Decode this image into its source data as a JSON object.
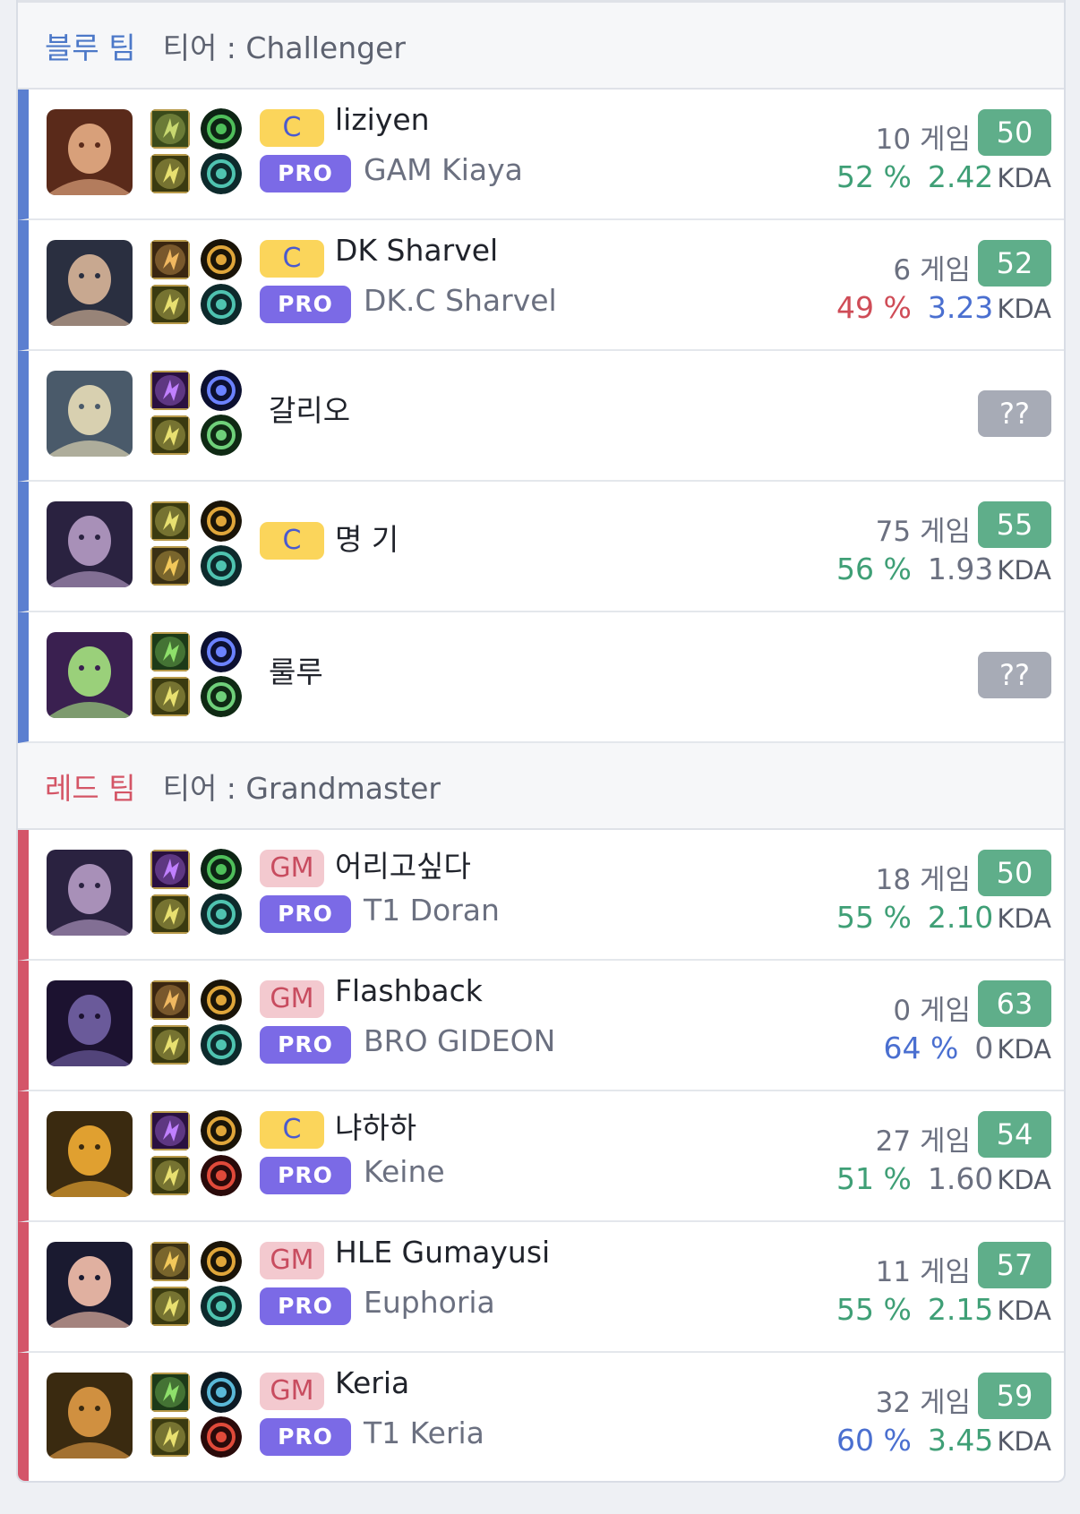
{
  "blue_team": {
    "name": "블루 팀",
    "tier_label": "티어 : Challenger",
    "players": [
      {
        "champion": "champion-portrait-talon",
        "spells": [
          "ghost",
          "flash"
        ],
        "runes": [
          "domination-keystone",
          "sorcery"
        ],
        "rank_badge": "C",
        "name": "liziyen",
        "pro_label": "PRO",
        "pro_name": "GAM Kiaya",
        "games": "10 게임",
        "lp": "50",
        "winrate": "52 %",
        "winrate_color": "green",
        "kda": "2.42",
        "kda_color": "green",
        "kda_unit": "KDA"
      },
      {
        "champion": "champion-portrait-jayce",
        "spells": [
          "teleport",
          "flash"
        ],
        "runes": [
          "precision-keystone",
          "sorcery"
        ],
        "rank_badge": "C",
        "name": "DK Sharvel",
        "pro_label": "PRO",
        "pro_name": "DK.C Sharvel",
        "games": "6 게임",
        "lp": "52",
        "winrate": "49 %",
        "winrate_color": "red",
        "kda": "3.23",
        "kda_color": "blue",
        "kda_unit": "KDA"
      },
      {
        "champion": "champion-portrait-galio",
        "spells": [
          "ignite",
          "flash"
        ],
        "runes": [
          "sorcery-keystone",
          "resolve"
        ],
        "rank_badge": "",
        "name": "갈리오",
        "pro_label": "",
        "pro_name": "",
        "games": "",
        "lp": "??",
        "winrate": "",
        "winrate_color": "gray",
        "kda": "",
        "kda_color": "gray",
        "kda_unit": ""
      },
      {
        "champion": "champion-portrait-aatrox",
        "spells": [
          "flash",
          "smite"
        ],
        "runes": [
          "precision-keystone",
          "sorcery"
        ],
        "rank_badge": "C",
        "name": "명 기",
        "pro_label": "",
        "pro_name": "",
        "games": "75 게임",
        "lp": "55",
        "winrate": "56 %",
        "winrate_color": "green",
        "kda": "1.93",
        "kda_color": "gray",
        "kda_unit": "KDA"
      },
      {
        "champion": "champion-portrait-lulu",
        "spells": [
          "heal",
          "flash"
        ],
        "runes": [
          "sorcery-keystone",
          "resolve"
        ],
        "rank_badge": "",
        "name": "룰루",
        "pro_label": "",
        "pro_name": "",
        "games": "",
        "lp": "??",
        "winrate": "",
        "winrate_color": "gray",
        "kda": "",
        "kda_color": "gray",
        "kda_unit": ""
      }
    ]
  },
  "red_team": {
    "name": "레드 팀",
    "tier_label": "티어 : Grandmaster",
    "players": [
      {
        "champion": "champion-portrait-aatrox",
        "spells": [
          "ignite",
          "flash"
        ],
        "runes": [
          "domination-keystone",
          "sorcery"
        ],
        "rank_badge": "GM",
        "name": "어리고싶다",
        "pro_label": "PRO",
        "pro_name": "T1 Doran",
        "games": "18 게임",
        "lp": "50",
        "winrate": "55 %",
        "winrate_color": "green",
        "kda": "2.10",
        "kda_color": "green",
        "kda_unit": "KDA"
      },
      {
        "champion": "champion-portrait-kha-zix",
        "spells": [
          "teleport",
          "flash"
        ],
        "runes": [
          "precision-keystone",
          "sorcery"
        ],
        "rank_badge": "GM",
        "name": "Flashback",
        "pro_label": "PRO",
        "pro_name": "BRO GIDEON",
        "games": "0 게임",
        "lp": "63",
        "winrate": "64 %",
        "winrate_color": "blue",
        "kda": "0",
        "kda_color": "gray",
        "kda_unit": "KDA"
      },
      {
        "champion": "champion-portrait-azir",
        "spells": [
          "ignite",
          "flash"
        ],
        "runes": [
          "precision-keystone",
          "domination"
        ],
        "rank_badge": "C",
        "name": "냐하하",
        "pro_label": "PRO",
        "pro_name": "Keine",
        "games": "27 게임",
        "lp": "54",
        "winrate": "51 %",
        "winrate_color": "green",
        "kda": "1.60",
        "kda_color": "gray",
        "kda_unit": "KDA"
      },
      {
        "champion": "champion-portrait-caitlyn",
        "spells": [
          "smite",
          "flash"
        ],
        "runes": [
          "precision-keystone",
          "sorcery"
        ],
        "rank_badge": "GM",
        "name": "HLE Gumayusi",
        "pro_label": "PRO",
        "pro_name": "Euphoria",
        "games": "11 게임",
        "lp": "57",
        "winrate": "55 %",
        "winrate_color": "green",
        "kda": "2.15",
        "kda_color": "green",
        "kda_unit": "KDA"
      },
      {
        "champion": "champion-portrait-blitzcrank",
        "spells": [
          "heal",
          "flash"
        ],
        "runes": [
          "inspiration-keystone",
          "domination"
        ],
        "rank_badge": "GM",
        "name": "Keria",
        "pro_label": "PRO",
        "pro_name": "T1 Keria",
        "games": "32 게임",
        "lp": "59",
        "winrate": "60 %",
        "winrate_color": "blue",
        "kda": "3.45",
        "kda_color": "green",
        "kda_unit": "KDA"
      }
    ]
  }
}
